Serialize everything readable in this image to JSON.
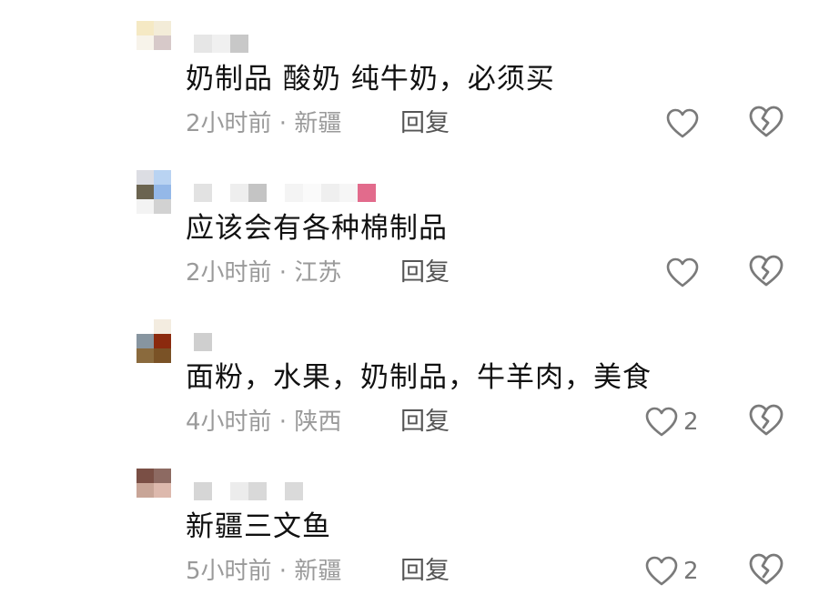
{
  "comments": [
    {
      "text": "奶制品  酸奶 纯牛奶，必须买",
      "time": "2小时前",
      "location": "新疆",
      "reply_label": "回复",
      "like_count": "",
      "avatar_colors": [
        "#f5e9c4",
        "#f3ecd8",
        "#f7f3ea",
        "#d7c9c9",
        "#ffffff",
        "#ffffff"
      ],
      "username_blocks": [
        "#e6e6e6",
        "#f0f0f0",
        "#c8c8c8"
      ]
    },
    {
      "text": "应该会有各种棉制品",
      "time": "2小时前",
      "location": "江苏",
      "reply_label": "回复",
      "like_count": "",
      "avatar_colors": [
        "#dcdde3",
        "#b9d3f2",
        "#6b6450",
        "#94b8e8",
        "#f3f3f3",
        "#d2d2d2"
      ],
      "username_blocks": [
        "#e2e2e2",
        "#ffffff",
        "#eeeeee",
        "#c4c4c4",
        "#ffffff",
        "#f4f4f4",
        "#fafafa",
        "#efefef",
        "#f6f6f6",
        "#e26b8c"
      ]
    },
    {
      "text": "面粉，水果，奶制品，牛羊肉，美食",
      "time": "4小时前",
      "location": "陕西",
      "reply_label": "回复",
      "like_count": "2",
      "avatar_colors": [
        "#ffffff",
        "#f3ece0",
        "#8795a0",
        "#8b2a0e",
        "#8a6a3d",
        "#7a5226"
      ],
      "username_blocks": [
        "#cfcfcf"
      ]
    },
    {
      "text": "新疆三文鱼",
      "time": "5小时前",
      "location": "新疆",
      "reply_label": "回复",
      "like_count": "2",
      "avatar_colors": [
        "#7a4f45",
        "#8d6a62",
        "#c8a597",
        "#ddb9ad",
        "#ffffff",
        "#ffffff"
      ],
      "username_blocks": [
        "#d6d6d6",
        "#ffffff",
        "#ececec",
        "#d9d9d9",
        "#ffffff",
        "#dadada"
      ]
    }
  ]
}
